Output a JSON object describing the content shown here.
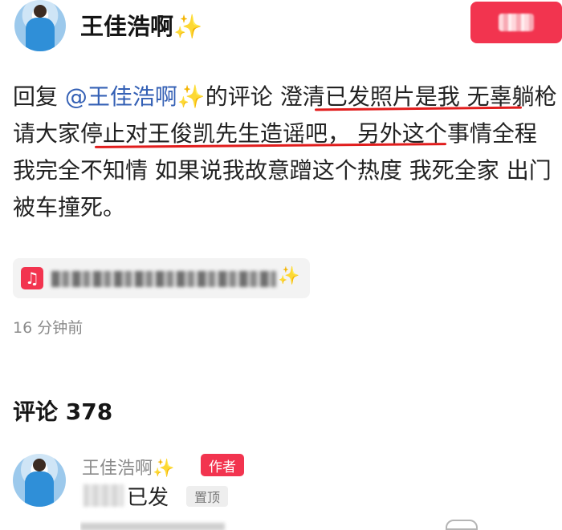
{
  "header": {
    "author_name": "王佳浩啊",
    "sparkle": "✨"
  },
  "reply": {
    "prefix": "回复 ",
    "mention": "@王佳浩啊",
    "mention_sparkle": "✨",
    "mention_suffix": "的评论 ",
    "underlined_1": "澄清已发照片是我",
    "mid_text": " 无辜躺枪 ",
    "underlined_2": "请大家停止对王俊凯先生造谣吧，",
    "tail_text": " 另外这个事情全程我完全不知情 如果说我故意蹭这个热度 我死全家 出门被车撞死。"
  },
  "music_chip": {
    "note_icon": "♫",
    "sparkle": "✨"
  },
  "timestamp": "16 分钟前",
  "comments": {
    "label": "评论",
    "count": "378",
    "top": {
      "name": "王佳浩啊",
      "sparkle": "✨",
      "author_badge": "作者",
      "text": "已发",
      "pin_badge": "置顶"
    }
  },
  "colors": {
    "accent_red": "#f2344f",
    "mention_blue": "#3460b5",
    "underline_red": "#e11c1c"
  }
}
